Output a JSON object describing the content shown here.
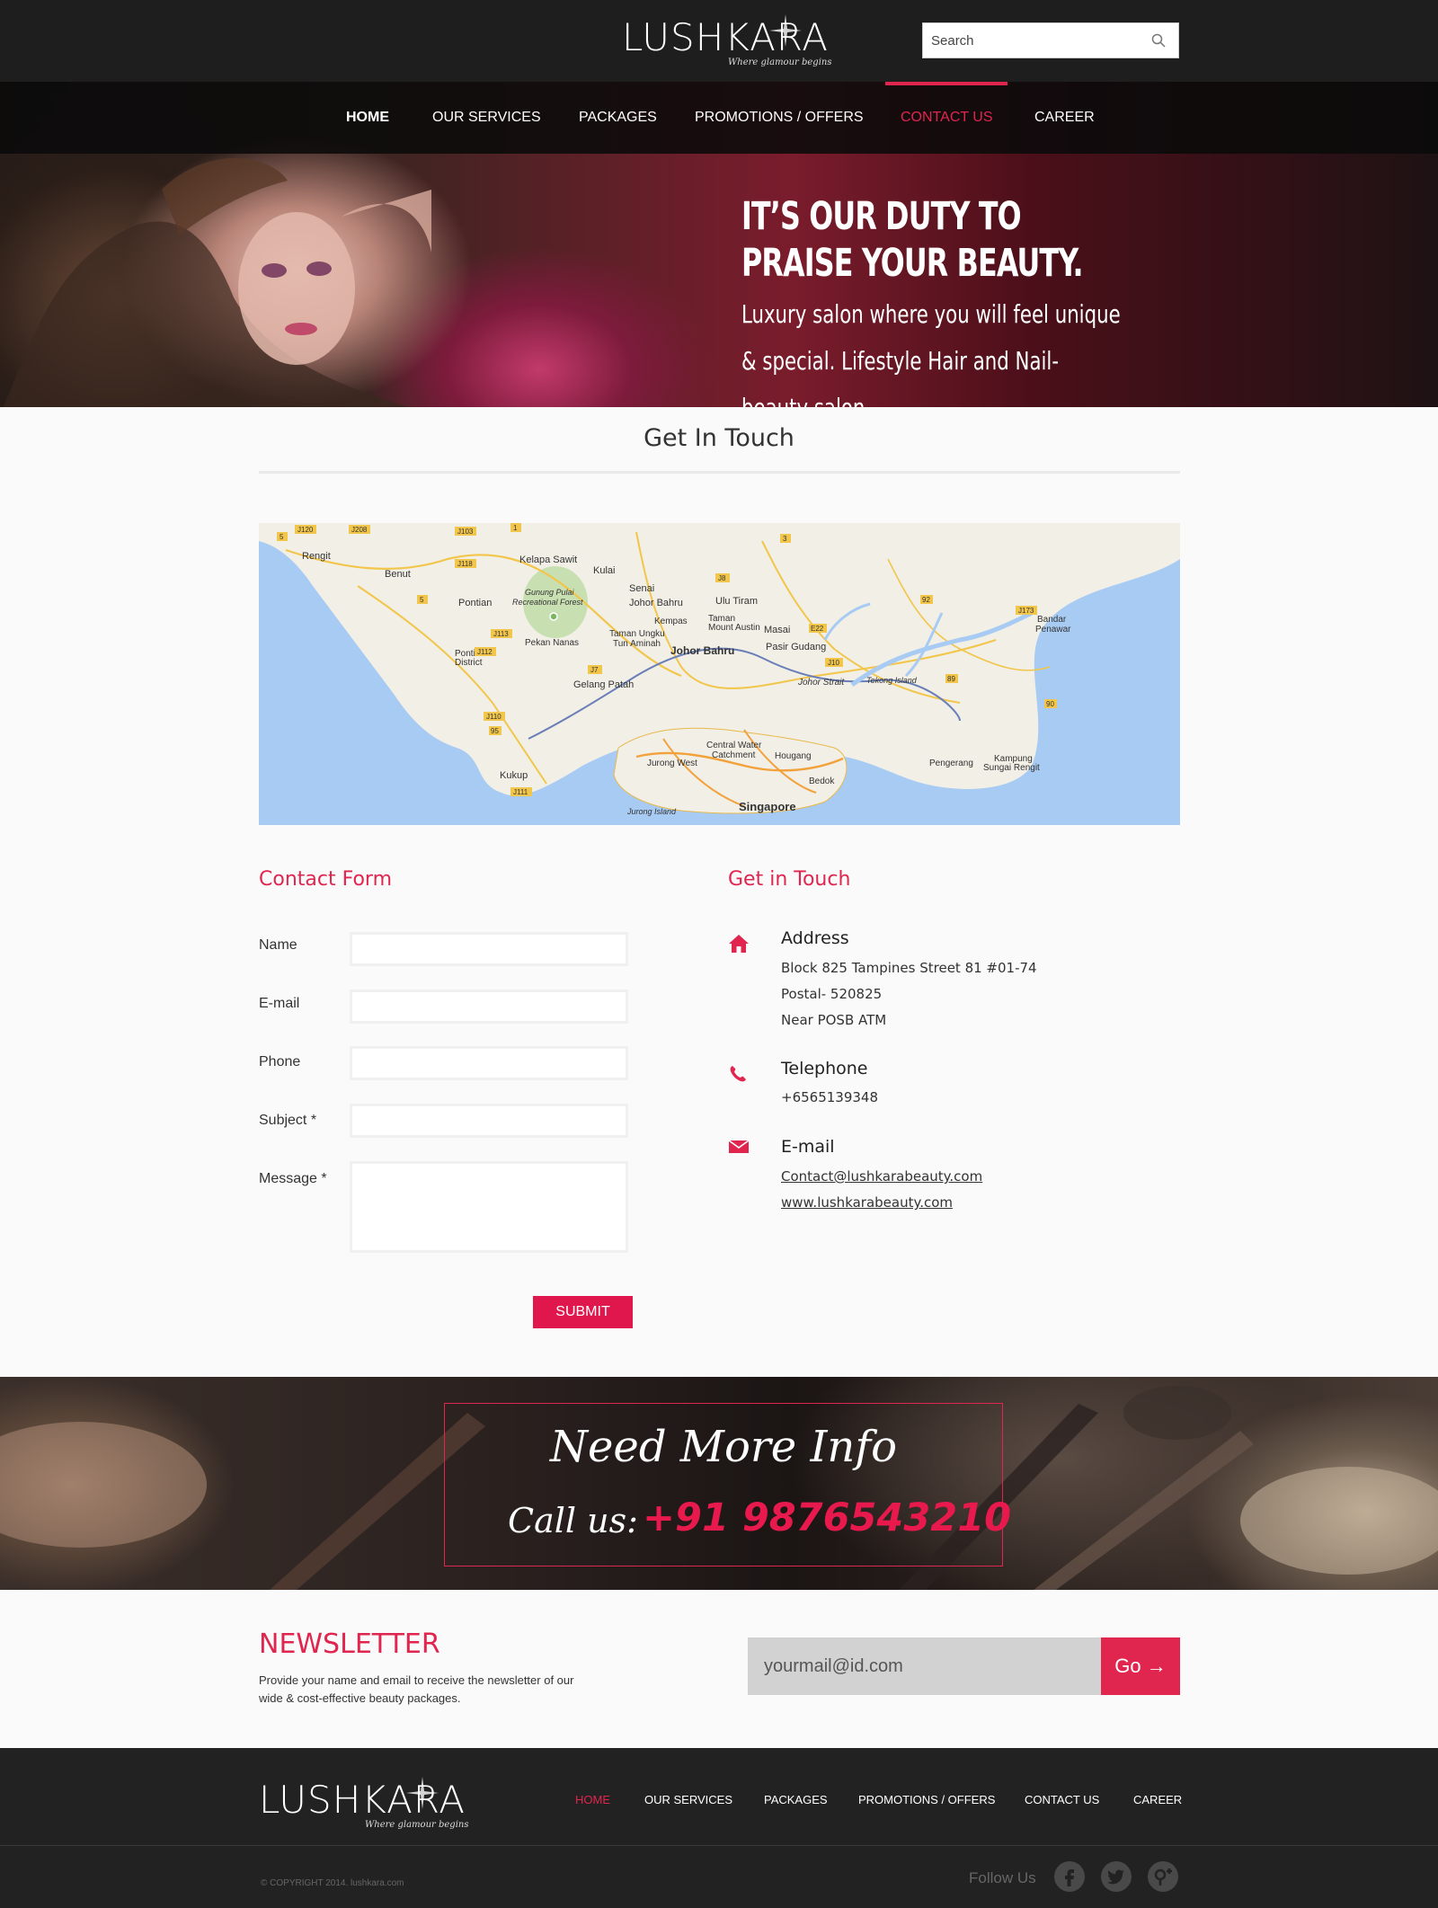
{
  "brand": {
    "name": "LUSHKARA",
    "tagline": "Where glamour begins",
    "accent_color": "#e0254f"
  },
  "search": {
    "placeholder": "Search",
    "icon": "magnifier"
  },
  "nav": {
    "items": [
      {
        "label": "HOME"
      },
      {
        "label": "OUR SERVICES"
      },
      {
        "label": "PACKAGES"
      },
      {
        "label": "PROMOTIONS / OFFERS"
      },
      {
        "label": "CONTACT US"
      },
      {
        "label": "CAREER"
      }
    ],
    "active": "CONTACT US"
  },
  "hero": {
    "headline": "IT’S OUR DUTY TO PRAISE YOUR BEAUTY.",
    "subtext": "Luxury salon where you will feel unique & special. Lifestyle Hair and Nail-beauty salon ."
  },
  "contact_section": {
    "title": "Get In Touch"
  },
  "map": {
    "labels": [
      "J120",
      "J208",
      "Rengit",
      "Benut",
      "J118",
      "J103",
      "Kelapa Sawit",
      "Kulai",
      "Senai",
      "Johor Bahru",
      "Ulu Tiram",
      "Pontian",
      "Gunung Pulai Recreational Forest",
      "J113",
      "Kempas",
      "Taman Mount Austin",
      "Taman Ungku Tun Aminah",
      "Pekan Nanas",
      "Pontian District",
      "J112",
      "Masai",
      "J10",
      "Pasir Gudang",
      "Bandar Penawar",
      "J173",
      "Johor Bahru",
      "Gelang Patah",
      "J110",
      "Johor Strait",
      "Tekong Island",
      "Pengerang",
      "Kampung Sungai Rengit",
      "Central Water Catchment",
      "Jurong West",
      "Hougang",
      "Bedok",
      "Kukup",
      "J111",
      "Singapore",
      "Jurong Island",
      "5",
      "1",
      "3",
      "J8",
      "92",
      "E22",
      "J7",
      "89",
      "90",
      "95"
    ]
  },
  "contact_form": {
    "title": "Contact Form",
    "fields": [
      {
        "label": "Name",
        "value": ""
      },
      {
        "label": "E-mail",
        "value": ""
      },
      {
        "label": "Phone",
        "value": ""
      },
      {
        "label": "Subject *",
        "value": ""
      },
      {
        "label": "Message *",
        "value": ""
      }
    ],
    "submit_label": "SUBMIT"
  },
  "contact_info": {
    "title": "Get in Touch",
    "address": {
      "heading": "Address",
      "icon": "home-icon",
      "lines": [
        "Block 825 Tampines Street 81 #01-74",
        "Postal- 520825",
        "Near POSB ATM"
      ]
    },
    "telephone": {
      "heading": "Telephone",
      "icon": "phone-icon",
      "number": "+6565139348"
    },
    "email": {
      "heading": "E-mail",
      "icon": "envelope-icon",
      "address": "Contact@lushkarabeauty.com",
      "website": "www.lushkarabeauty.com"
    }
  },
  "cta": {
    "title": "Need More Info",
    "call_label": "Call us:",
    "phone": "+91 9876543210"
  },
  "newsletter": {
    "title": "NEWSLETTER",
    "description": "Provide your name and email to receive the newsletter of our wide & cost-effective beauty packages.",
    "input_placeholder": "yourmail@id.com",
    "button_label": "Go →"
  },
  "footer": {
    "nav": [
      "HOME",
      "OUR SERVICES",
      "PACKAGES",
      "PROMOTIONS / OFFERS",
      "CONTACT US",
      "CAREER"
    ],
    "active": "HOME",
    "copyright": "© COPYRIGHT 2014. lushkara.com",
    "follow_label": "Follow Us",
    "social": [
      "facebook-icon",
      "twitter-icon",
      "google-plus-icon"
    ]
  }
}
